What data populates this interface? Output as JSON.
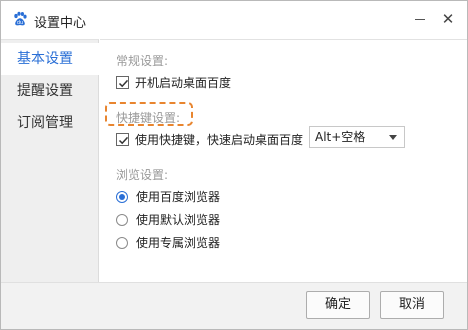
{
  "window": {
    "title": "设置中心",
    "icon": "baidu-paw-icon",
    "controls": {
      "minimize_icon": "minimize-icon",
      "close_glyph": "✕"
    }
  },
  "sidebar": {
    "items": [
      {
        "label": "基本设置",
        "active": true
      },
      {
        "label": "提醒设置",
        "active": false
      },
      {
        "label": "订阅管理",
        "active": false
      }
    ]
  },
  "general": {
    "title": "常规设置:",
    "autostart_label": "开机启动桌面百度",
    "autostart_checked": true
  },
  "hotkey": {
    "title": "快捷键设置:",
    "enable_label": "使用快捷键，快速启动桌面百度",
    "enable_checked": true,
    "combo_value": "Alt+空格"
  },
  "browser": {
    "title": "浏览设置:",
    "options": [
      {
        "label": "使用百度浏览器",
        "selected": true
      },
      {
        "label": "使用默认浏览器",
        "selected": false
      },
      {
        "label": "使用专属浏览器",
        "selected": false
      }
    ]
  },
  "footer": {
    "ok_label": "确定",
    "cancel_label": "取消"
  },
  "colors": {
    "accent": "#2a6fd6",
    "highlight_border": "#e8852f"
  }
}
